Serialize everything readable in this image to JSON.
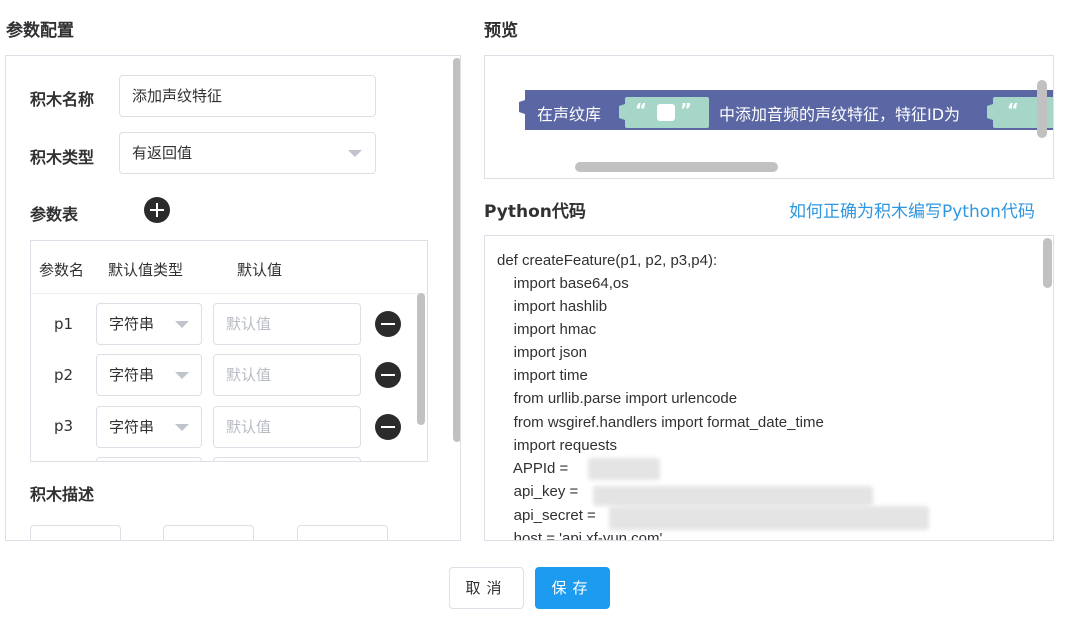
{
  "left": {
    "title": "参数配置",
    "block_name_label": "积木名称",
    "block_name_value": "添加声纹特征",
    "block_type_label": "积木类型",
    "block_type_value": "有返回值",
    "params_label": "参数表",
    "table": {
      "headers": [
        "参数名",
        "默认值类型",
        "默认值"
      ],
      "rows": [
        {
          "name": "p1",
          "type": "字符串",
          "placeholder": "默认值"
        },
        {
          "name": "p2",
          "type": "字符串",
          "placeholder": "默认值"
        },
        {
          "name": "p3",
          "type": "字符串",
          "placeholder": "默认值"
        }
      ]
    },
    "description_label": "积木描述"
  },
  "right": {
    "preview_title": "预览",
    "block_text_1": "在声纹库",
    "block_text_2": "中添加音频的声纹特征，特征ID为",
    "quote_open": "“",
    "quote_close": "”",
    "code_title": "Python代码",
    "help_link": "如何正确为积木编写Python代码",
    "code_lines": [
      "def createFeature(p1, p2, p3,p4):",
      "    import base64,os",
      "    import hashlib",
      "    import hmac",
      "    import json",
      "    import time",
      "    from urllib.parse import urlencode",
      "    from wsgiref.handlers import format_date_time",
      "    import requests",
      "    APPId =",
      "    api_key =",
      "    api_secret =",
      "    host = 'api.xf-yun.com'"
    ]
  },
  "footer": {
    "cancel": "取消",
    "save": "保存"
  },
  "colors": {
    "block": "#5b67a5",
    "slot": "#a6d6c7",
    "primary": "#1d9bf0",
    "link": "#2f96e0"
  }
}
